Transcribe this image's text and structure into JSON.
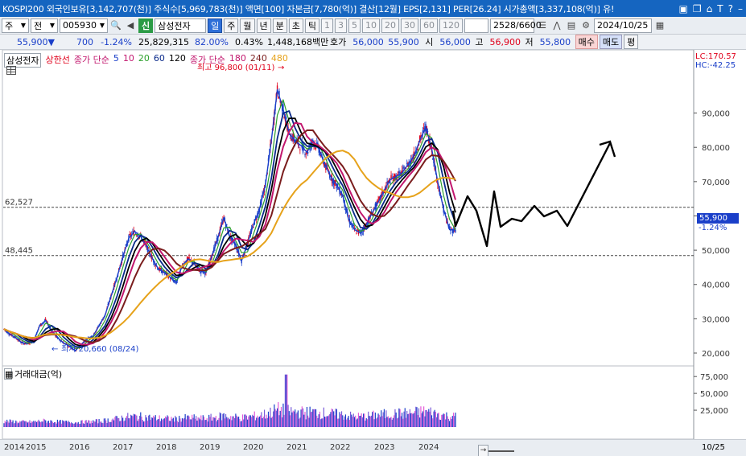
{
  "titlebar": {
    "text": "KOSPI200 외국인보유[3,142,707(천)] 주식수[5,969,783(천)] 액면[100] 자본금[7,780(억)] 결산[12월] EPS[2,131] PER[26.24] 시가총액[3,337,108(억)] 유!",
    "icons": [
      "restore-icon",
      "copy-icon",
      "pin-icon",
      "font-icon",
      "help-icon",
      "minimize-icon"
    ]
  },
  "toolbar": {
    "market": "주",
    "scope": "전",
    "code": "005930",
    "tag": "신",
    "name": "삼성전자",
    "periods": [
      "일",
      "주",
      "월",
      "년",
      "분",
      "초",
      "틱"
    ],
    "selected_period": "일",
    "counts": [
      "1",
      "3",
      "5",
      "10",
      "20",
      "30",
      "60",
      "120"
    ],
    "range": "2528",
    "range_total": "/6600",
    "date": "2024/10/25"
  },
  "quote": {
    "price": "55,900",
    "arrow": "▼",
    "change": "700",
    "change_pct": "-1.24%",
    "volume": "25,829,315",
    "ratio": "82.00%",
    "turnover": "0.43%",
    "amount": "1,448,168백만",
    "ho_label": "호가",
    "ho1": "56,000",
    "ho2": "55,900",
    "open_label": "시",
    "open": "56,000",
    "high_label": "고",
    "high": "56,900",
    "low_label": "저",
    "low": "55,800",
    "buy_label": "매수",
    "sell_label": "매도",
    "flat_label": "평"
  },
  "legend": {
    "stock": "삼성전자",
    "upper": "상한선",
    "ma_label": "종가 단순",
    "ma": [
      "5",
      "10",
      "20",
      "60",
      "120"
    ],
    "ma2_label": "종가 단순",
    "ma2": [
      "180",
      "240",
      "480"
    ]
  },
  "chart_data": {
    "type": "line",
    "series": [
      {
        "values": [
          27000,
          25500,
          24500,
          23000,
          22800,
          23500,
          28000,
          29500,
          26500,
          24500,
          23000,
          22000,
          20660,
          22500,
          24200,
          25000,
          28000,
          31000,
          36500,
          42000,
          48000,
          53500,
          55500,
          54000,
          51000,
          47500,
          44500,
          43500,
          42000,
          40500,
          45500,
          47500,
          46000,
          44000,
          43500,
          48500,
          53500,
          59500,
          54000,
          51500,
          47000,
          52000,
          57500,
          62000,
          69000,
          82000,
          96800,
          91000,
          84000,
          82000,
          80500,
          78500,
          82000,
          79500,
          75000,
          71500,
          69000,
          66000,
          59000,
          56000,
          55000,
          57500,
          61000,
          64000,
          67500,
          70500,
          71500,
          72500,
          75000,
          77500,
          82000,
          86000,
          79500,
          70000,
          62000,
          56000,
          55900
        ]
      }
    ],
    "dates": [
      "2014/01",
      "2014/03",
      "2014/05",
      "2014/07",
      "2014/09",
      "2014/11",
      "2015/01",
      "2015/03",
      "2015/05",
      "2015/07",
      "2015/09",
      "2015/11",
      "2016/01",
      "2016/03",
      "2016/05",
      "2016/07",
      "2016/09",
      "2016/11",
      "2017/01",
      "2017/03",
      "2017/05",
      "2017/07",
      "2017/09",
      "2017/11",
      "2018/01",
      "2018/03",
      "2018/05",
      "2018/07",
      "2018/09",
      "2018/11",
      "2019/01",
      "2019/03",
      "2019/05",
      "2019/07",
      "2019/09",
      "2019/11",
      "2020/01",
      "2020/03",
      "2020/05",
      "2020/07",
      "2020/09",
      "2020/11",
      "2021/01",
      "2021/03",
      "2021/05",
      "2021/07",
      "2021/09",
      "2021/11",
      "2022/01",
      "2022/03",
      "2022/05",
      "2022/07",
      "2022/09",
      "2022/11",
      "2023/01",
      "2023/03",
      "2023/05",
      "2023/07",
      "2023/09",
      "2023/11",
      "2024/01",
      "2024/03",
      "2024/05",
      "2024/07",
      "2024/09",
      "2024/10"
    ],
    "ylim": [
      20000,
      96000
    ],
    "y_ticks": [
      "90,000",
      "80,000",
      "70,000",
      "60,000",
      "50,000",
      "40,000",
      "30,000",
      "20,000"
    ],
    "x_ticks": [
      "2014",
      "2015",
      "2016",
      "2017",
      "2018",
      "2019",
      "2020",
      "2021",
      "2022",
      "2023",
      "2024"
    ],
    "hlines": [
      {
        "label": "62,527",
        "value": 62527
      },
      {
        "label": "48,445",
        "value": 48445
      }
    ],
    "max_annotation": "최고 96,800 (01/11)",
    "min_annotation": "최저 20,660 (08/24)",
    "volume_label": "거래대금(억)",
    "volume_ticks": [
      "75,000",
      "50,000",
      "25,000"
    ],
    "grid": false
  },
  "right_info": {
    "lc": "LC:170.57",
    "hc": "HC:-42.25",
    "price_tag": "55,900",
    "pct_tag": "-1.24%"
  },
  "bottom": {
    "end_date": "10/25"
  },
  "colors": {
    "titlebar": "#1565c0",
    "up": "#e0001b",
    "down": "#1a3fc9",
    "ma5": "#1a3fc9",
    "ma20": "#2ca02c",
    "ma60": "#0a2a8a",
    "ma120": "#000000",
    "ma180": "#c2176e",
    "ma240": "#7a1d1d",
    "ma480": "#e6a21a"
  }
}
